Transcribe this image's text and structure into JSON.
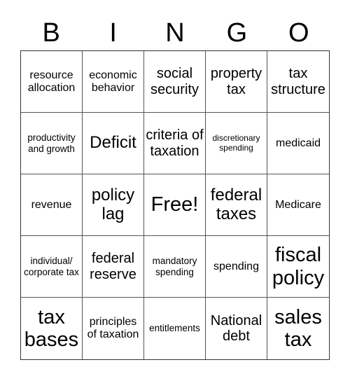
{
  "header": {
    "letters": [
      "B",
      "I",
      "N",
      "G",
      "O"
    ]
  },
  "card": {
    "cells": [
      {
        "text": "resource allocation",
        "size": "s-md"
      },
      {
        "text": "economic behavior",
        "size": "s-md"
      },
      {
        "text": "social security",
        "size": "s-lg"
      },
      {
        "text": "property tax",
        "size": "s-lg"
      },
      {
        "text": "tax structure",
        "size": "s-lg"
      },
      {
        "text": "productivity and growth",
        "size": "s-sm"
      },
      {
        "text": "Deficit",
        "size": "s-xl"
      },
      {
        "text": "criteria of taxation",
        "size": "s-lg"
      },
      {
        "text": "discretionary spending",
        "size": "s-xs"
      },
      {
        "text": "medicaid",
        "size": "s-md"
      },
      {
        "text": "revenue",
        "size": "s-md"
      },
      {
        "text": "policy lag",
        "size": "s-xl"
      },
      {
        "text": "Free!",
        "size": "s-xxl"
      },
      {
        "text": "federal taxes",
        "size": "s-xl"
      },
      {
        "text": "Medicare",
        "size": "s-md"
      },
      {
        "text": "individual/ corporate tax",
        "size": "s-sm"
      },
      {
        "text": "federal reserve",
        "size": "s-lg"
      },
      {
        "text": "mandatory spending",
        "size": "s-sm"
      },
      {
        "text": "spending",
        "size": "s-md"
      },
      {
        "text": "fiscal policy",
        "size": "s-xxl"
      },
      {
        "text": "tax bases",
        "size": "s-xxl"
      },
      {
        "text": "principles of taxation",
        "size": "s-md"
      },
      {
        "text": "entitlements",
        "size": "s-sm"
      },
      {
        "text": "National debt",
        "size": "s-lg"
      },
      {
        "text": "sales tax",
        "size": "s-xxl"
      }
    ]
  }
}
